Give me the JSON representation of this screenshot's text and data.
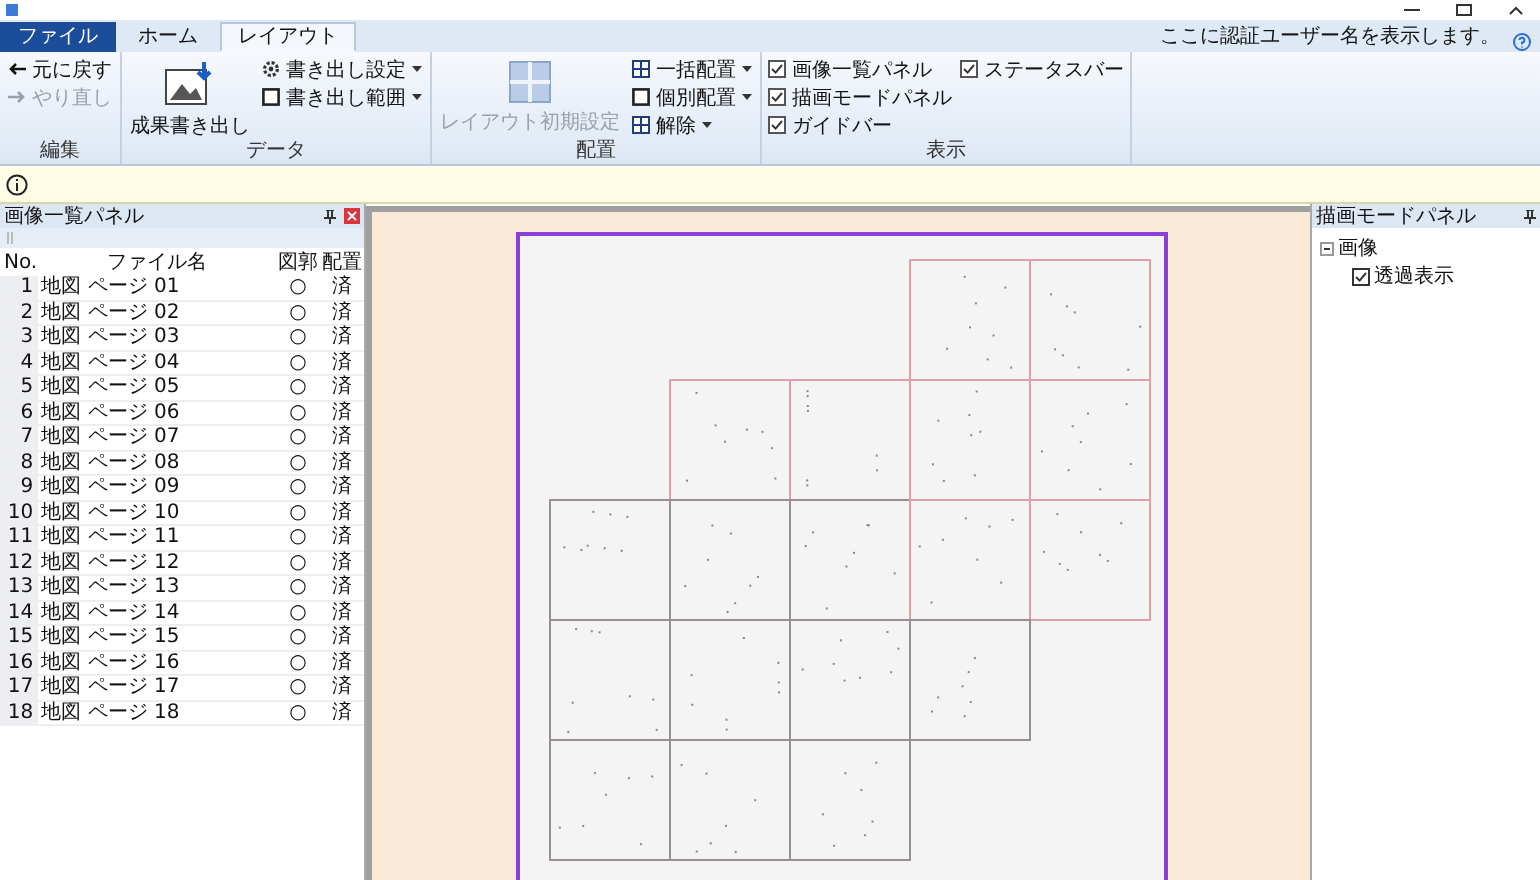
{
  "tabs": [
    {
      "label": "ファイル",
      "kind": "file",
      "selected": false
    },
    {
      "label": "ホーム",
      "kind": "tab",
      "selected": false
    },
    {
      "label": "レイアウト",
      "kind": "tab",
      "selected": true
    }
  ],
  "user_notice": "ここに認証ユーザー名を表示します。",
  "ribbon": [
    {
      "title": "編集",
      "items": [
        {
          "kind": "small",
          "label": "元に戻す",
          "disabled": false
        },
        {
          "kind": "small",
          "label": "やり直し",
          "disabled": true
        }
      ]
    },
    {
      "title": "データ",
      "items": [
        {
          "kind": "large",
          "label": "成果書き出し",
          "disabled": false
        },
        {
          "kind": "small",
          "label": "書き出し設定",
          "dropdown": true,
          "disabled": false
        },
        {
          "kind": "small",
          "label": "書き出し範囲",
          "dropdown": true,
          "disabled": false
        }
      ]
    },
    {
      "title": "配置",
      "items": [
        {
          "kind": "large",
          "label": "レイアウト初期設定",
          "disabled": true
        },
        {
          "kind": "small",
          "label": "一括配置",
          "dropdown": true,
          "disabled": false
        },
        {
          "kind": "small",
          "label": "個別配置",
          "dropdown": true,
          "disabled": false
        },
        {
          "kind": "small",
          "label": "解除",
          "dropdown": true,
          "disabled": false
        }
      ]
    },
    {
      "title": "表示",
      "items": [
        {
          "kind": "check",
          "label": "画像一覧パネル",
          "checked": true
        },
        {
          "kind": "check",
          "label": "描画モードパネル",
          "checked": true
        },
        {
          "kind": "check",
          "label": "ガイドバー",
          "checked": true
        },
        {
          "kind": "check",
          "label": "ステータスバー",
          "checked": true
        }
      ]
    }
  ],
  "left_panel": {
    "title": "画像一覧パネル",
    "columns": [
      "No.",
      "ファイル名",
      "図郭",
      "配置"
    ],
    "rows": [
      [
        "1",
        "地図 ページ 01",
        "○",
        "済"
      ],
      [
        "2",
        "地図 ページ 02",
        "○",
        "済"
      ],
      [
        "3",
        "地図 ページ 03",
        "○",
        "済"
      ],
      [
        "4",
        "地図 ページ 04",
        "○",
        "済"
      ],
      [
        "5",
        "地図 ページ 05",
        "○",
        "済"
      ],
      [
        "6",
        "地図 ページ 06",
        "○",
        "済"
      ],
      [
        "7",
        "地図 ページ 07",
        "○",
        "済"
      ],
      [
        "8",
        "地図 ページ 08",
        "○",
        "済"
      ],
      [
        "9",
        "地図 ページ 09",
        "○",
        "済"
      ],
      [
        "10",
        "地図 ページ 10",
        "○",
        "済"
      ],
      [
        "11",
        "地図 ページ 11",
        "○",
        "済"
      ],
      [
        "12",
        "地図 ページ 12",
        "○",
        "済"
      ],
      [
        "13",
        "地図 ページ 13",
        "○",
        "済"
      ],
      [
        "14",
        "地図 ページ 14",
        "○",
        "済"
      ],
      [
        "15",
        "地図 ページ 15",
        "○",
        "済"
      ],
      [
        "16",
        "地図 ページ 16",
        "○",
        "済"
      ],
      [
        "17",
        "地図 ページ 17",
        "○",
        "済"
      ],
      [
        "18",
        "地図 ページ 18",
        "○",
        "済"
      ]
    ]
  },
  "right_panel": {
    "title": "描画モードパネル",
    "tree": [
      {
        "label": "画像",
        "expanded": true,
        "children": [
          {
            "label": "透過表示",
            "checked": true
          }
        ]
      }
    ]
  }
}
